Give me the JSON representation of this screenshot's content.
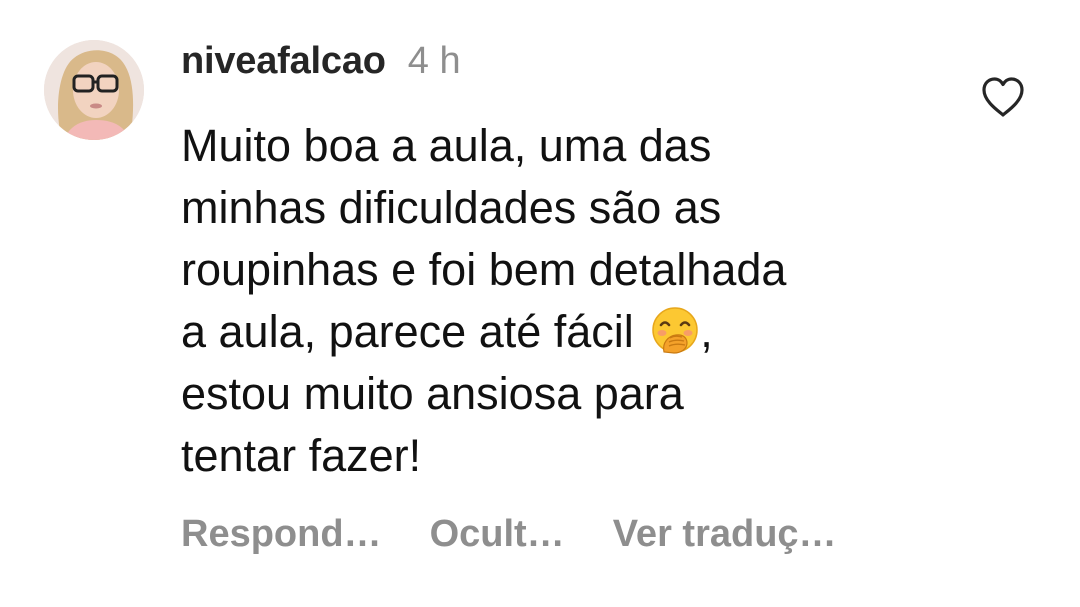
{
  "comment": {
    "username": "niveafalcao",
    "time_ago": "4 h",
    "text_before_emoji": "Muito boa a aula, uma das\nminhas dificuldades são as\nroupinhas e foi bem detalhada\na aula, parece até fácil ",
    "emoji": "face-with-hand-over-mouth",
    "text_after_emoji": ",\nestou muito ansiosa para\ntentar fazer!",
    "liked": false,
    "actions": {
      "reply": "Respond…",
      "hide": "Ocult…",
      "translate": "Ver traduç…"
    }
  },
  "icons": {
    "like": "heart-outline-icon",
    "avatar": "user-avatar"
  },
  "colors": {
    "text": "#111111",
    "username": "#262626",
    "muted": "#8e8e8e",
    "background": "#ffffff"
  }
}
